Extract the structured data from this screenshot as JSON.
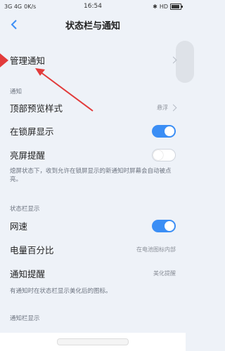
{
  "status_bar": {
    "left": "3G 4G",
    "speed": "0K/s",
    "time": "16:54",
    "right": "HD",
    "battery_level": 0.8
  },
  "header": {
    "title": "状态栏与通知"
  },
  "rows": {
    "manage_notifications": {
      "label": "管理通知"
    },
    "top_preview_style": {
      "label": "顶部预览样式",
      "value": "悬浮"
    },
    "lockscreen_display": {
      "label": "在锁屏显示",
      "toggle": true
    },
    "wake_screen": {
      "label": "亮屏提醒",
      "toggle": false
    },
    "network_speed": {
      "label": "网速",
      "toggle": true
    },
    "battery_percent": {
      "label": "电量百分比",
      "value": "在电池图标内部"
    },
    "notification_reminder": {
      "label": "通知提醒",
      "value": "美化提醒"
    }
  },
  "sections": {
    "notification": "通知",
    "statusbar": "状态栏显示",
    "notification_bar": "通知栏显示"
  },
  "notes": {
    "wake_screen_note": "熄屏状态下，收到允许在锁屏显示的新通知时屏幕会自动被点亮。",
    "reminder_note": "有通知时在状态栏显示美化后的图标。"
  },
  "colors": {
    "accent": "#3b8ef5",
    "arrow": "#e23b3b",
    "background": "#eef2f8"
  }
}
